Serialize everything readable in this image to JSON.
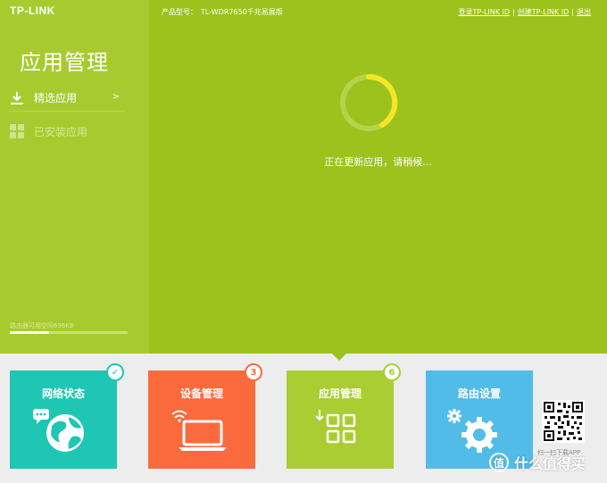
{
  "header": {
    "logo": "TP-LINK",
    "model_label": "产品型号：",
    "model_value": "TL-WDR7650千兆易展版",
    "login_link": "登录TP-LINK ID",
    "create_link": "创建TP-LINK ID",
    "logout_link": "退出"
  },
  "sidebar": {
    "title": "应用管理",
    "items": [
      {
        "label": "精选应用",
        "icon": "download-icon",
        "arrow": ">"
      },
      {
        "label": "已安装应用",
        "icon": "grid-icon"
      }
    ],
    "storage_label": "路由器可用空间696KB",
    "storage_fraction": 0.33
  },
  "main": {
    "loading_text": "正在更新应用，请稍候..."
  },
  "tiles": [
    {
      "title": "网络状态",
      "badge": "✓",
      "icon": "globe-icon",
      "color": "#1fc6b4"
    },
    {
      "title": "设备管理",
      "badge": "3",
      "icon": "laptop-wifi-icon",
      "color": "#fa6a3d"
    },
    {
      "title": "应用管理",
      "badge": "6",
      "icon": "apps-grid-icon",
      "color": "#a9cd32"
    },
    {
      "title": "路由设置",
      "badge": "",
      "icon": "gear-icon",
      "color": "#52bce8"
    }
  ],
  "qr": {
    "caption": "扫一扫下载APP"
  },
  "watermark": {
    "glyph": "值",
    "text": "什么值得买"
  },
  "colors": {
    "sidebar": "#a7cb2e",
    "main": "#9dc21e",
    "spinner": "#f5e625"
  }
}
